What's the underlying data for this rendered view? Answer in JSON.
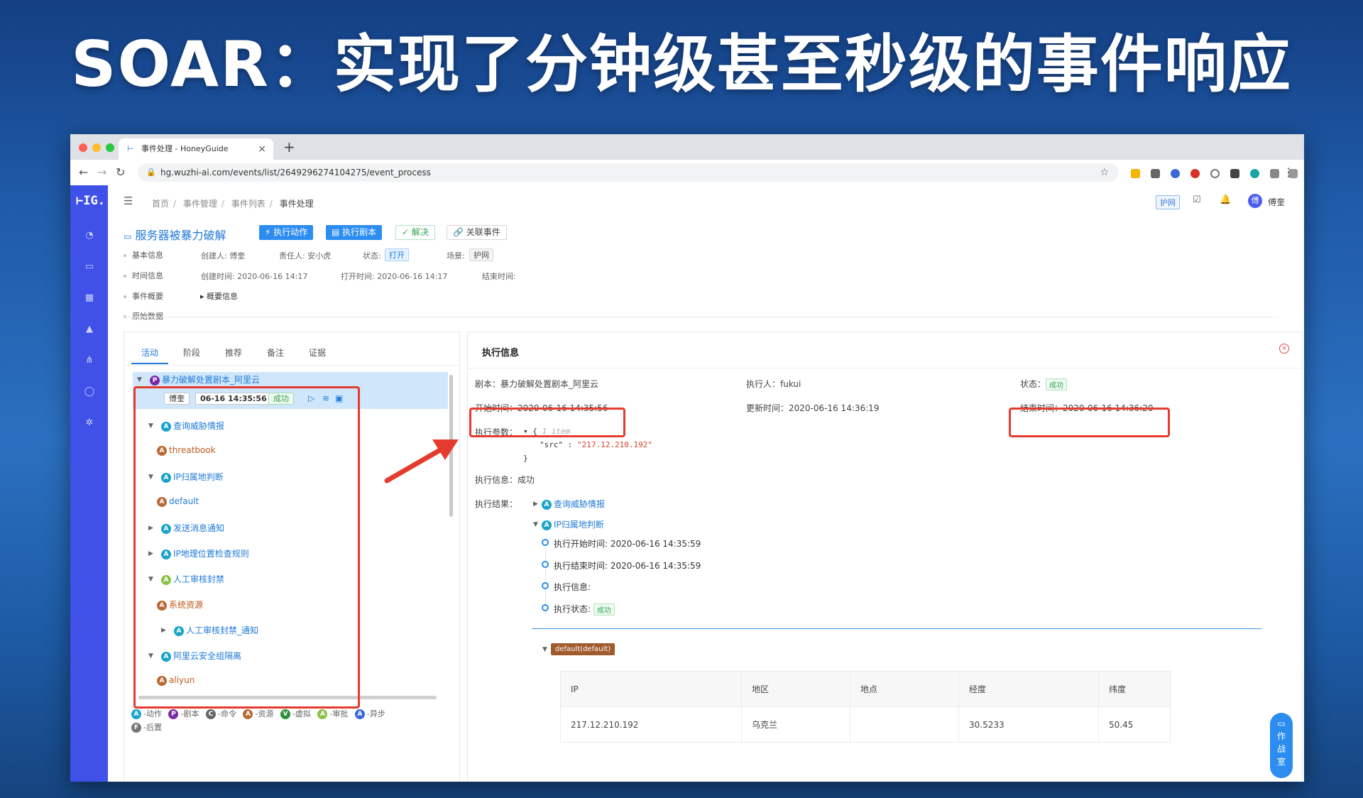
{
  "slide": {
    "title": "SOAR：实现了分钟级甚至秒级的事件响应"
  },
  "browser": {
    "tab_title": "事件处理 - HoneyGuide",
    "tab_logo": "⊢",
    "url": "hg.wuzhi-ai.com/events/list/2649296274104275/event_process",
    "icons": [
      "back-icon",
      "forward-icon",
      "reload-icon",
      "lock-icon",
      "star-icon",
      "menu-icon"
    ]
  },
  "sidebar": {
    "logo": "⊢IG.",
    "icons": [
      "dashboard-icon",
      "monitor-icon",
      "grid-icon",
      "alert-icon",
      "network-icon",
      "user-icon",
      "settings-icon"
    ]
  },
  "topbar": {
    "breadcrumbs": [
      "首页",
      "事件管理",
      "事件列表",
      "事件处理"
    ],
    "badge": "护网",
    "user_initial": "傅",
    "username": "傅奎"
  },
  "event": {
    "title": "服务器被暴力破解",
    "buttons": {
      "run_action": "执行动作",
      "run_playbook": "执行剧本",
      "resolve": "解决",
      "link_event": "关联事件"
    },
    "sections": {
      "basic": "基本信息",
      "time": "时间信息",
      "summary": "事件概要",
      "raw": "原始数据"
    },
    "creator": "创建人: 傅奎",
    "owner": "责任人: 安小虎",
    "status_label": "状态:",
    "status_value": "打开",
    "scene_label": "场景:",
    "scene_value": "护网",
    "create_time": "创建时间: 2020-06-16 14:17",
    "open_time": "打开时间: 2020-06-16 14:17",
    "end_time": "结束时间:",
    "summary_toggle": "概要信息"
  },
  "left_panel": {
    "tabs": [
      "活动",
      "阶段",
      "推荐",
      "备注",
      "证据"
    ],
    "root": {
      "label": "暴力破解处置剧本_阿里云",
      "badge": "P",
      "user": "傅奎",
      "time": "06-16 14:35:56",
      "status": "成功"
    },
    "nodes": [
      {
        "badge": "A",
        "type": "action",
        "label": "查询威胁情报",
        "expanded": true
      },
      {
        "badge": "A",
        "type": "resource",
        "label": "threatbook"
      },
      {
        "badge": "A",
        "type": "action",
        "label": "IP归属地判断",
        "expanded": true
      },
      {
        "badge": "A",
        "type": "resource",
        "label": "default"
      },
      {
        "badge": "A",
        "type": "action",
        "label": "发送消息通知",
        "expanded": false
      },
      {
        "badge": "A",
        "type": "action",
        "label": "IP地理位置检查规则",
        "expanded": false
      },
      {
        "badge": "A",
        "type": "approval",
        "label": "人工审核封禁",
        "expanded": true
      },
      {
        "badge": "A",
        "type": "resource",
        "label": "系统资源"
      },
      {
        "badge": "A",
        "type": "action",
        "label": "人工审核封禁_通知",
        "expanded": false
      },
      {
        "badge": "A",
        "type": "action",
        "label": "阿里云安全组隔离",
        "expanded": true
      },
      {
        "badge": "A",
        "type": "resource",
        "label": "aliyun"
      }
    ],
    "legend": [
      {
        "badge": "A",
        "text": "-动作"
      },
      {
        "badge": "P",
        "text": "-剧本"
      },
      {
        "badge": "C",
        "text": "-命令"
      },
      {
        "badge": "A",
        "text": "-资源"
      },
      {
        "badge": "V",
        "text": "-虚拟"
      },
      {
        "badge": "A",
        "text": "-审批"
      },
      {
        "badge": "A",
        "text": "-异步"
      },
      {
        "badge": "F",
        "text": "-后置"
      }
    ]
  },
  "exec": {
    "header": "执行信息",
    "playbook": "剧本：暴力破解处置剧本_阿里云",
    "executor": "执行人：fukui",
    "status_label": "状态：",
    "status_value": "成功",
    "start_time": "开始时间：2020-06-16 14:35:56",
    "update_time": "更新时间：2020-06-16 14:36:19",
    "end_time": "结束时间：2020-06-16 14:36:20",
    "params_label": "执行参数：",
    "params_open": "{",
    "params_comment": "1 item",
    "params_key": "\"src\"",
    "params_colon": " : ",
    "params_value": "\"217.12.210.192\"",
    "params_close": "}",
    "info_label": "执行信息：",
    "info_value": "成功",
    "result_label": "执行结果：",
    "result_nodes": [
      "查询威胁情报",
      "IP归属地判断"
    ],
    "timeline": [
      "执行开始时间: 2020-06-16 14:35:59",
      "执行结束时间: 2020-06-16 14:35:59",
      "执行信息:",
      "执行状态:"
    ],
    "timeline_status": "成功",
    "default_tag": "default(default)",
    "table": {
      "headers": [
        "IP",
        "地区",
        "地点",
        "经度",
        "纬度"
      ],
      "row": [
        "217.12.210.192",
        "乌克兰",
        "",
        "30.5233",
        "50.45"
      ]
    }
  },
  "float_button": [
    "作",
    "战",
    "室"
  ],
  "colors": {
    "sidebar": "#3f51e7",
    "primary": "#2c8df0",
    "highlight": "#e53b2e"
  }
}
